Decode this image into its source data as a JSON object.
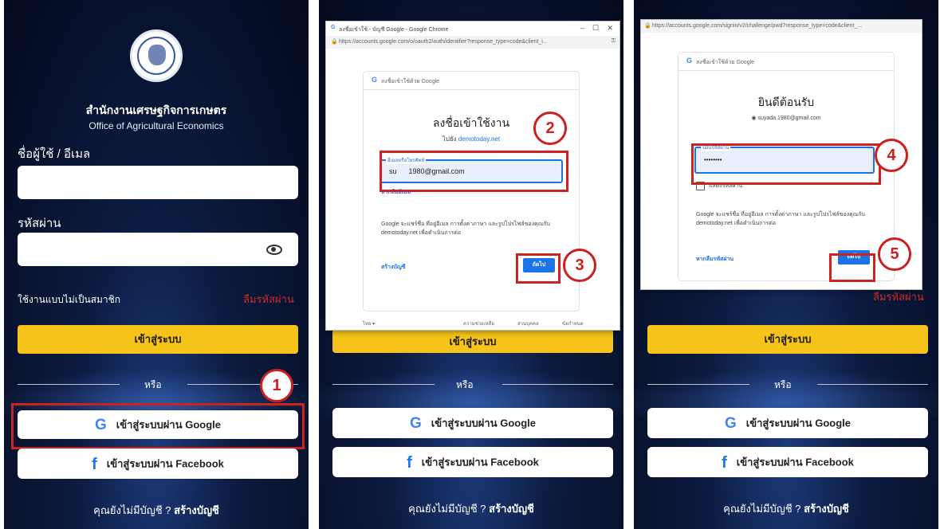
{
  "login": {
    "org_name_th": "สำนักงานเศรษฐกิจการเกษตร",
    "org_name_en": "Office of Agricultural Economics",
    "username_label": "ชื่อผู้ใช้ / อีเมล",
    "password_label": "รหัสผ่าน",
    "guest_text": "ใช้งานแบบไม่เป็นสมาชิก",
    "forgot_text": "ลืมรหัสผ่าน",
    "login_button": "เข้าสู่ระบบ",
    "or_text": "หรือ",
    "google_button": "เข้าสู่ระบบผ่าน Google",
    "facebook_button": "เข้าสู่ระบบผ่าน Facebook",
    "footer_prefix": "คุณยังไม่มีบัญชี ?",
    "footer_link": "สร้างบัญชี"
  },
  "chrome_popup": {
    "title": "ลงชื่อเข้าใช้ - บัญชี Google - Google Chrome",
    "url": "https://accounts.google.com/o/oauth2/auth/identifier?response_type=code&client_i...",
    "google_header": "ลงชื่อเข้าใช้ด้วย Google",
    "heading": "ลงชื่อเข้าใช้งาน",
    "sub_prefix": "ไปยัง",
    "sub_link": "demotoday.net",
    "email_label": "อีเมลหรือโทรศัพท์",
    "email_value": "su      1980@gmail.com",
    "forgot_email": "หากลืมอีเมล",
    "info_text": "Google จะแชร์ชื่อ ที่อยู่อีเมล การตั้งค่าภาษา และรูปโปรไฟล์ของคุณกับ demotoday.net เพื่อดำเนินการต่อ",
    "create_account": "สร้างบัญชี",
    "next_button": "ถัดไป",
    "footer_lang": "ไทย ▾",
    "footer_help": "ความช่วยเหลือ",
    "footer_privacy": "ส่วนบุคคล",
    "footer_terms": "ข้อกำหนด"
  },
  "password_popup": {
    "url": "https://accounts.google.com/signin/v2/challenge/pwd?response_type=code&client_...",
    "google_header": "ลงชื่อเข้าใช้ด้วย Google",
    "heading": "ยินดีต้อนรับ",
    "account_email": "suyada.1980@gmail.com",
    "password_label": "ป้อนรหัสผ่าน",
    "password_value": "••••••••",
    "show_password": "แสดงรหัสผ่าน",
    "info_text": "Google จะแชร์ชื่อ ที่อยู่อีเมล การตั้งค่าภาษา และรูปโปรไฟล์ของคุณกับ demotoday.net เพื่อดำเนินการต่อ",
    "forgot_password": "หากลืมรหัสผ่าน",
    "next_button": "ถัดไป"
  },
  "steps": [
    "1",
    "2",
    "3",
    "4",
    "5"
  ],
  "colors": {
    "accent_yellow": "#f6c31a",
    "highlight_red": "#cc2222",
    "google_blue": "#1a73e8",
    "forgot_red": "#d22b2b"
  }
}
